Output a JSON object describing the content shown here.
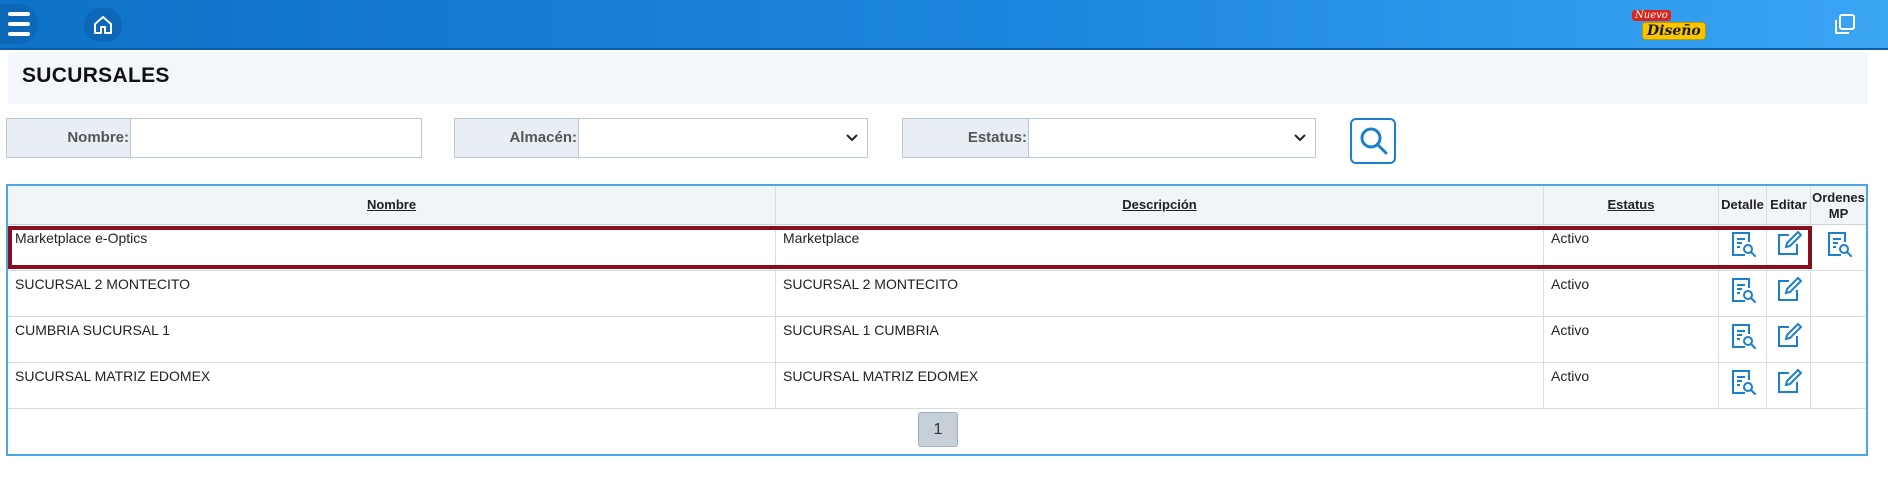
{
  "topbar": {
    "menu_icon": "hamburger-menu-icon",
    "home_icon": "home-icon",
    "badge": {
      "top": "Nuevo",
      "main": "Diseño"
    },
    "window_icon": "restore-window-icon",
    "colors": {
      "bar": "#1d86de",
      "accent": "#0e72c6"
    }
  },
  "page": {
    "title": "SUCURSALES"
  },
  "filters": {
    "nombre": {
      "label": "Nombre:",
      "value": ""
    },
    "almacen": {
      "label": "Almacén:",
      "value": ""
    },
    "estatus": {
      "label": "Estatus:",
      "value": ""
    },
    "search_icon": "search-icon"
  },
  "table": {
    "headers": {
      "nombre": "Nombre",
      "descripcion": "Descripción",
      "estatus": "Estatus",
      "detalle": "Detalle",
      "editar": "Editar",
      "ordenes_1": "Ordenes",
      "ordenes_2": "MP"
    },
    "rows": [
      {
        "nombre": "Marketplace e-Optics",
        "descripcion": "Marketplace",
        "estatus": "Activo",
        "has_ordenes": true
      },
      {
        "nombre": "SUCURSAL 2 MONTECITO",
        "descripcion": "SUCURSAL 2 MONTECITO",
        "estatus": "Activo",
        "has_ordenes": false
      },
      {
        "nombre": "CUMBRIA SUCURSAL 1",
        "descripcion": "SUCURSAL 1 CUMBRIA",
        "estatus": "Activo",
        "has_ordenes": false
      },
      {
        "nombre": "SUCURSAL MATRIZ EDOMEX",
        "descripcion": "SUCURSAL MATRIZ EDOMEX",
        "estatus": "Activo",
        "has_ordenes": false
      }
    ],
    "highlight_color": "#8a0f1e",
    "icon_color": "#1a7fcf"
  },
  "pagination": {
    "current": "1"
  }
}
